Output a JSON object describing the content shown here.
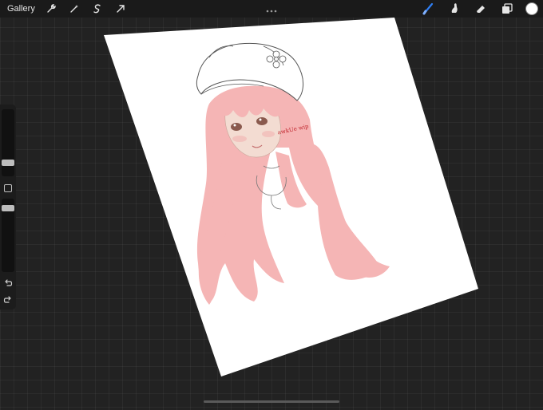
{
  "toolbar": {
    "gallery_label": "Gallery",
    "left_tools": [
      "wrench-icon",
      "magic-wand-icon",
      "selection-icon",
      "transform-arrow-icon"
    ],
    "right_tools": [
      "brush-icon",
      "smudge-icon",
      "eraser-icon",
      "layers-icon"
    ],
    "active_tool": "brush-icon",
    "accent_color": "#2f7ff5",
    "current_color": "#ffffff"
  },
  "sidebar": {
    "brush_size": 0.45,
    "opacity": 0.85
  },
  "artwork": {
    "signature_text": "awkUe wip",
    "hair_color": "#f5b5b5",
    "paper_color": "#ffffff"
  }
}
